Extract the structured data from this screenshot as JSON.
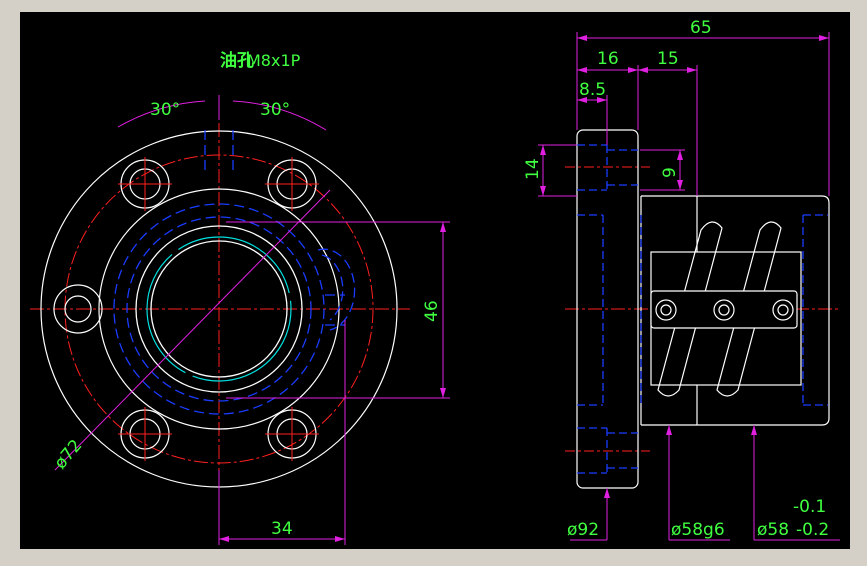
{
  "drawing": {
    "oil_hole_label": "油孔",
    "thread_label": "M8x1P",
    "angle_left": "30°",
    "angle_right": "30°",
    "dim_46": "46",
    "dim_34": "34",
    "dia_72": "ø72",
    "dim_65": "65",
    "dim_16": "16",
    "dim_15": "15",
    "dim_8_5": "8.5",
    "dim_14": "14",
    "dim_9": "9",
    "dia_92": "ø92",
    "dia_58g6": "ø58g6",
    "dia_58": "ø58",
    "tol_upper": "-0.1",
    "tol_lower": "-0.2"
  },
  "colors": {
    "frame": "#d4d0c8",
    "background": "#000000",
    "outline": "#ffffff",
    "hidden": "#1a3cff",
    "center": "#ff2020",
    "dimension": "#e020e0",
    "dim_text": "#40ff40",
    "cyan": "#00e0e0"
  }
}
